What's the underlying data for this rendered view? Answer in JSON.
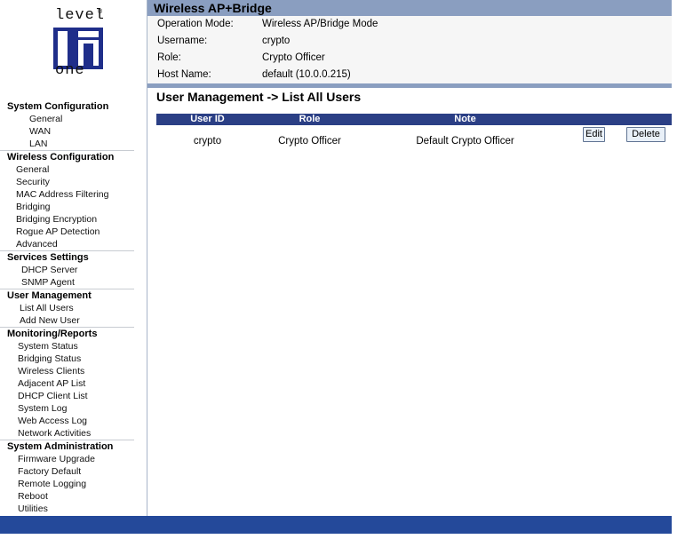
{
  "brand": {
    "logo_top": "level",
    "logo_bottom": "one",
    "registered": "®"
  },
  "header": {
    "title": "Wireless AP+Bridge"
  },
  "info": [
    {
      "key": "Operation Mode:",
      "value": "Wireless AP/Bridge Mode"
    },
    {
      "key": "Username:",
      "value": "crypto"
    },
    {
      "key": "Role:",
      "value": "Crypto Officer"
    },
    {
      "key": "Host Name:",
      "value": "default (10.0.0.215)"
    }
  ],
  "page_title": "User Management -> List All Users",
  "table": {
    "columns": [
      "User ID",
      "Role",
      "Note"
    ],
    "rows": [
      {
        "user_id": "crypto",
        "role": "Crypto Officer",
        "note": "Default Crypto Officer",
        "edit": "Edit",
        "delete": "Delete"
      }
    ]
  },
  "nav": [
    {
      "title": "System Configuration",
      "items": [
        "General",
        "WAN",
        "LAN"
      ]
    },
    {
      "title": "Wireless Configuration",
      "items": [
        "General",
        "Security",
        "MAC Address Filtering",
        "Bridging",
        "Bridging Encryption",
        "Rogue AP Detection",
        "Advanced"
      ]
    },
    {
      "title": "Services Settings",
      "items": [
        "DHCP Server",
        "SNMP Agent"
      ]
    },
    {
      "title": "User Management",
      "items": [
        "List All Users",
        "Add New User"
      ]
    },
    {
      "title": "Monitoring/Reports",
      "items": [
        "System Status",
        "Bridging Status",
        "Wireless Clients",
        "Adjacent AP List",
        "DHCP Client List",
        "System Log",
        "Web Access Log",
        "Network Activities"
      ]
    },
    {
      "title": "System Administration",
      "items": [
        "Firmware Upgrade",
        "Factory Default",
        "Remote Logging",
        "Reboot",
        "Utilities"
      ]
    }
  ],
  "colors": {
    "header_bar": "#8a9ec0",
    "table_header": "#2b3f85",
    "footer_bar": "#24499a"
  }
}
